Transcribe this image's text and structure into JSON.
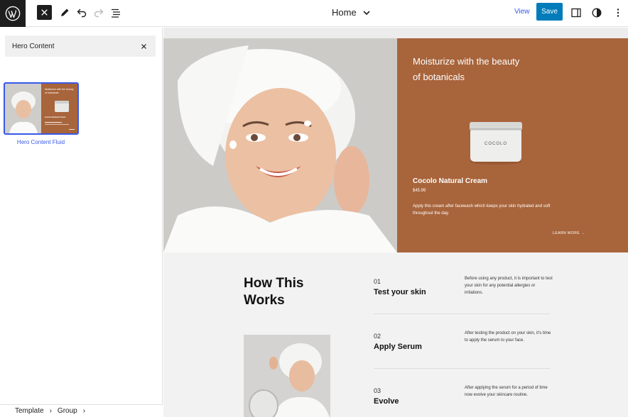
{
  "toolbar": {
    "title": "Home",
    "view_label": "View",
    "save_label": "Save"
  },
  "sidebar": {
    "search_value": "Hero Content",
    "pattern_label": "Hero Content Fluid",
    "breadcrumb": [
      "Template",
      "Group"
    ],
    "thumb_heading": "Moisturize with the beauty of botanicals",
    "thumb_product": "Cocolo Natural Cream"
  },
  "hero": {
    "heading": "Moisturize with the beauty of botanicals",
    "jar_brand": "COCOLO",
    "product_name": "Cocolo Natural Cream",
    "price": "$45.99",
    "description": "Apply this cream after facewash which keeps your skin hydrated and soft throughout the day.",
    "cta": "LEARN MORE →"
  },
  "works": {
    "title": "How This Works",
    "steps": [
      {
        "num": "01",
        "title": "Test your skin",
        "desc": "Before using any product, it is important to test your skin for any potential allergies or irritations."
      },
      {
        "num": "02",
        "title": "Apply Serum",
        "desc": "After testing the product on your skin, it's time to apply the serum to your face."
      },
      {
        "num": "03",
        "title": "Evolve",
        "desc": "After applying the serum for a period of time now evolve your skincare routine."
      }
    ]
  },
  "colors": {
    "accent": "#3858e9",
    "save": "#007cba",
    "hero_panel": "#a8643b",
    "dark": "#1e1e1e"
  },
  "icons": [
    "wordpress-icon",
    "close-icon",
    "pencil-icon",
    "undo-icon",
    "redo-icon",
    "list-view-icon",
    "chevron-down-icon",
    "settings-sidebar-icon",
    "styles-icon",
    "more-vertical-icon",
    "chevron-right-icon"
  ]
}
